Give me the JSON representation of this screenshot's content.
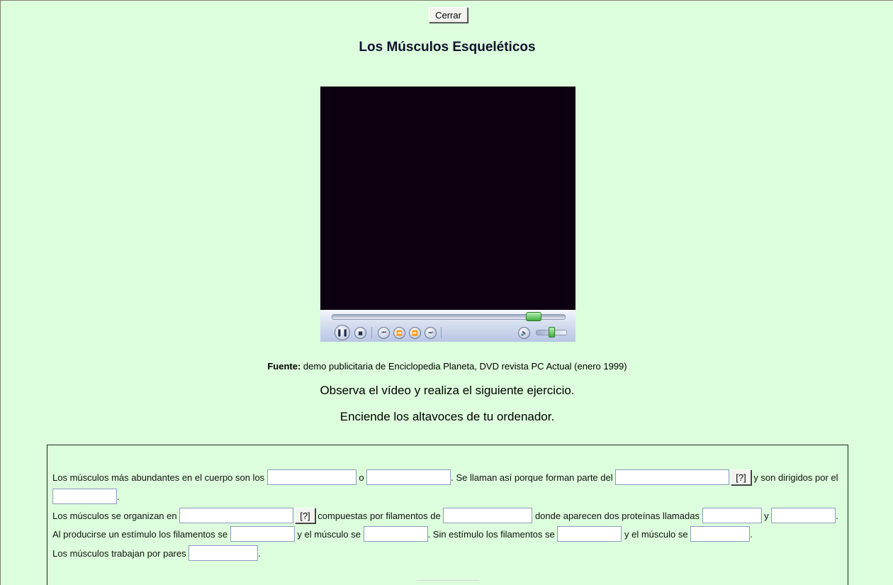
{
  "header": {
    "close_label": "Cerrar",
    "title": "Los Músculos Esqueléticos"
  },
  "player": {
    "seek_progress": 0.89,
    "volume_level": 0.5,
    "icons": [
      "pause-icon",
      "stop-icon",
      "previous-icon",
      "rewind-icon",
      "fast-forward-icon",
      "next-icon",
      "volume-icon"
    ]
  },
  "source": {
    "label": "Fuente:",
    "text": " demo publicitaria de Enciclopedia Planeta, DVD revista PC Actual (enero 1999)"
  },
  "instructions": {
    "line1": "Observa el vídeo y realiza el siguiente ejercicio.",
    "line2": "Enciende los altavoces de tu ordenador."
  },
  "exercise": {
    "help_label": "[?]",
    "s1_a": "Los músculos más abundantes en el cuerpo son los ",
    "s1_b": " o ",
    "s1_c": ". Se llaman así porque forman parte del ",
    "s1_d": " y son dirigidos por el",
    "s1_end": ".",
    "s2_a": "Los músculos se organizan en ",
    "s2_b": " compuestas por filamentos de ",
    "s2_c": " donde aparecen dos proteínas llamadas ",
    "s2_d": " y ",
    "s2_end": ".",
    "s3_a": "Al producirse un estímulo los filamentos se ",
    "s3_b": " y el músculo se ",
    "s3_c": ". Sin estímulo los filamentos se ",
    "s3_d": " y el músculo se ",
    "s3_end": ".",
    "s4_a": "Los músculos trabajan por pares ",
    "s4_end": "."
  }
}
